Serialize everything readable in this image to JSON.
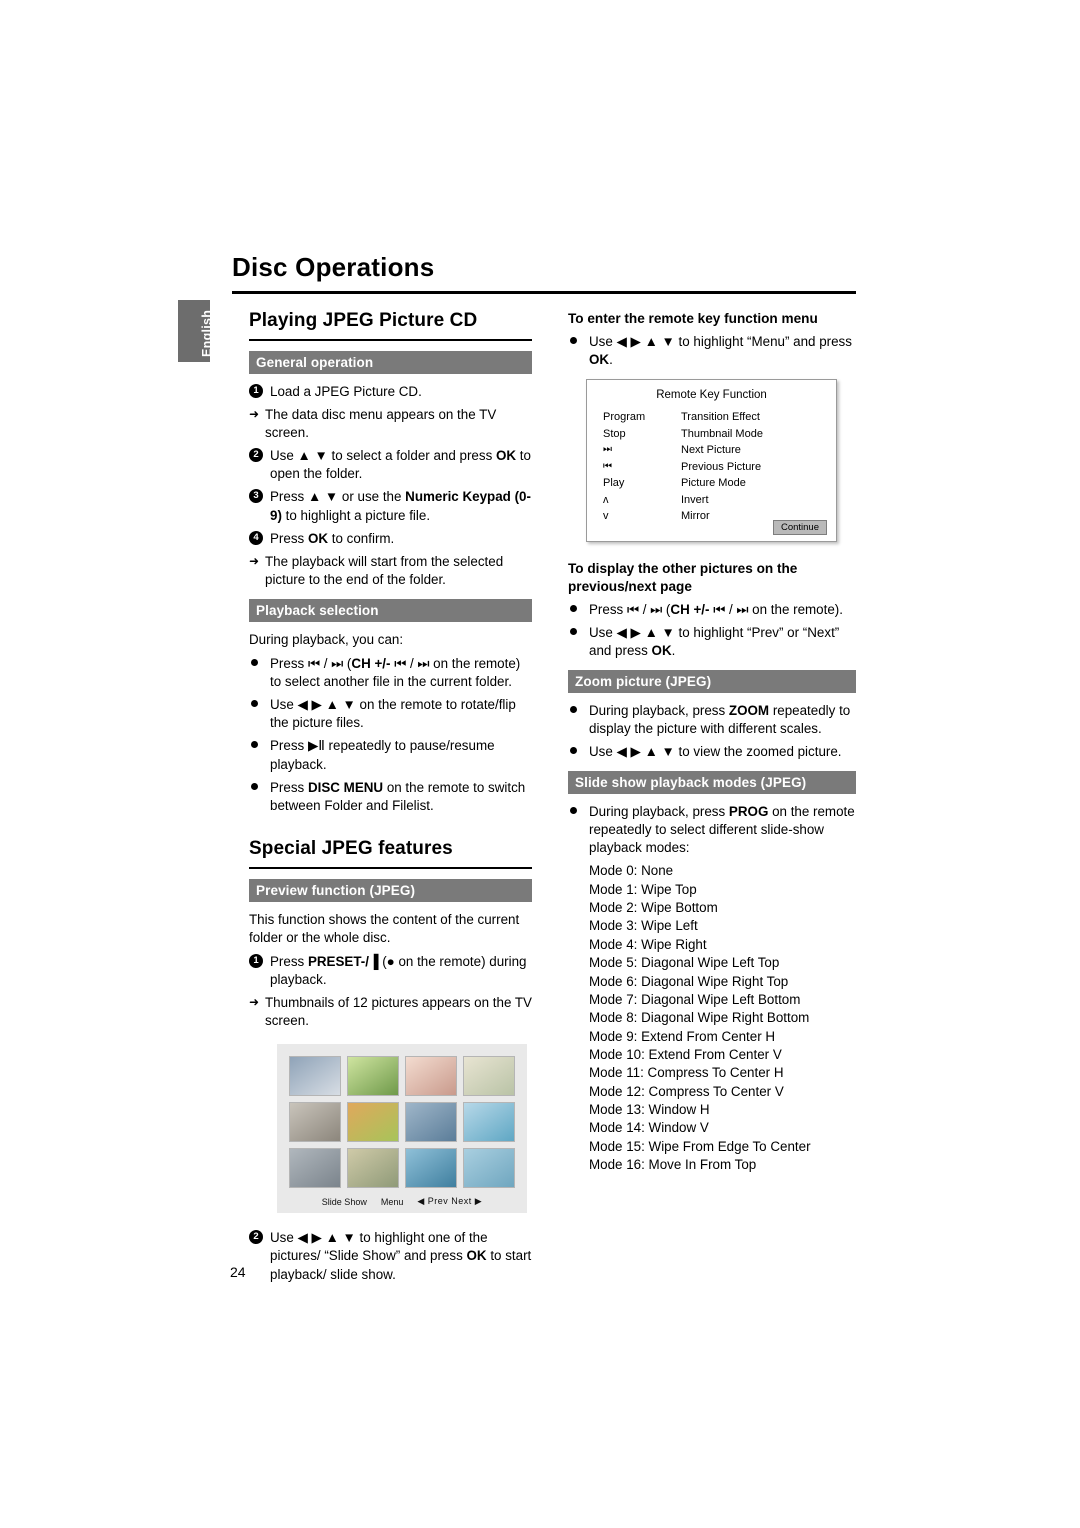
{
  "header": {
    "title": "Disc Operations",
    "language_tab": "English"
  },
  "page_number": "24",
  "left_column": {
    "section1_title": "Playing JPEG Picture CD",
    "general_operation_bar": "General operation",
    "general_steps": [
      {
        "num": "1",
        "text": "Load a JPEG Picture CD."
      },
      {
        "arrow": "➜",
        "text": "The data disc menu appears on the TV screen."
      },
      {
        "num": "2",
        "text_html": "Use ▲ ▼ to select a folder and press <b>OK</b> to open the folder."
      },
      {
        "num": "3",
        "text_html": "Press ▲ ▼ or use the <b>Numeric Keypad (0-9)</b> to highlight a picture file."
      },
      {
        "num": "4",
        "text_html": "Press <b>OK</b> to confirm."
      },
      {
        "arrow": "➜",
        "text": "The playback will start from the selected picture to the end of the folder."
      }
    ],
    "playback_selection_bar": "Playback selection",
    "playback_intro": "During playback, you can:",
    "playback_items": [
      "Press ⏮ / ⏭ (CH +/- ⏮ / ⏭ on the remote) to select another file in the current folder.",
      "Use ◀ ▶ ▲ ▼ on the remote to rotate/flip the picture files.",
      "Press ▶Ⅱ repeatedly to pause/resume playback.",
      "Press DISC MENU on the remote to switch between Folder and Filelist."
    ],
    "section2_title": "Special JPEG features",
    "preview_bar": "Preview function (JPEG)",
    "preview_text": "This function shows the content of the current folder or the whole disc.",
    "preview_steps": [
      {
        "num": "1",
        "text_html": "Press <b>PRESET-/▐</b> (● on the remote) during playback."
      },
      {
        "arrow": "➜",
        "text": "Thumbnails of 12 pictures appears on the TV screen."
      }
    ],
    "thumbnail_panel": {
      "slide_show_label": "Slide Show",
      "menu_label": "Menu",
      "prev_next_label": "◀ Prev Next ▶"
    },
    "final_step": {
      "num": "2",
      "text_html": "Use ◀ ▶ ▲ ▼ to highlight one of the pictures/ “Slide Show” and press <b>OK</b> to start playback/ slide show."
    }
  },
  "right_column": {
    "remote_key_heading": "To enter the remote key function menu",
    "remote_key_bullet_html": "Use ◀ ▶ ▲ ▼ to highlight “Menu” and press <b>OK</b>.",
    "remote_key_box": {
      "title": "Remote Key Function",
      "rows": [
        {
          "key": "Program",
          "value": "Transition Effect"
        },
        {
          "key": "Stop",
          "value": "Thumbnail Mode"
        },
        {
          "key": "⏭",
          "value": "Next Picture"
        },
        {
          "key": "⏮",
          "value": "Previous Picture"
        },
        {
          "key": "Play",
          "value": "Picture Mode"
        },
        {
          "key": "ʌ",
          "value": "Invert"
        },
        {
          "key": "v",
          "value": "Mirror"
        }
      ],
      "button": "Continue"
    },
    "other_pictures_heading": "To display the other pictures on the previous/next page",
    "other_pictures_items": [
      "Press ⏮ / ⏭ (CH +/- ⏮ / ⏭ on the remote).",
      "Use ◀ ▶ ▲ ▼ to highlight “Prev” or “Next” and press OK."
    ],
    "zoom_bar": "Zoom picture (JPEG)",
    "zoom_items": [
      "During playback, press ZOOM repeatedly to display the picture with different scales.",
      "Use ◀ ▶ ▲ ▼ to view the zoomed picture."
    ],
    "slideshow_bar": "Slide show playback modes (JPEG)",
    "slideshow_intro": "During playback, press PROG on the remote repeatedly to select different slide-show playback modes:",
    "modes": [
      "Mode 0: None",
      "Mode 1: Wipe Top",
      "Mode 2: Wipe Bottom",
      "Mode 3: Wipe Left",
      "Mode 4: Wipe Right",
      "Mode 5: Diagonal Wipe Left Top",
      "Mode 6: Diagonal Wipe Right Top",
      "Mode 7: Diagonal Wipe Left Bottom",
      "Mode 8: Diagonal Wipe Right Bottom",
      "Mode 9: Extend From Center H",
      "Mode 10: Extend From Center V",
      "Mode 11: Compress To Center H",
      "Mode 12: Compress To Center V",
      "Mode 13: Window H",
      "Mode 14: Window V",
      "Mode 15: Wipe From Edge To Center",
      "Mode 16: Move In From Top"
    ]
  }
}
